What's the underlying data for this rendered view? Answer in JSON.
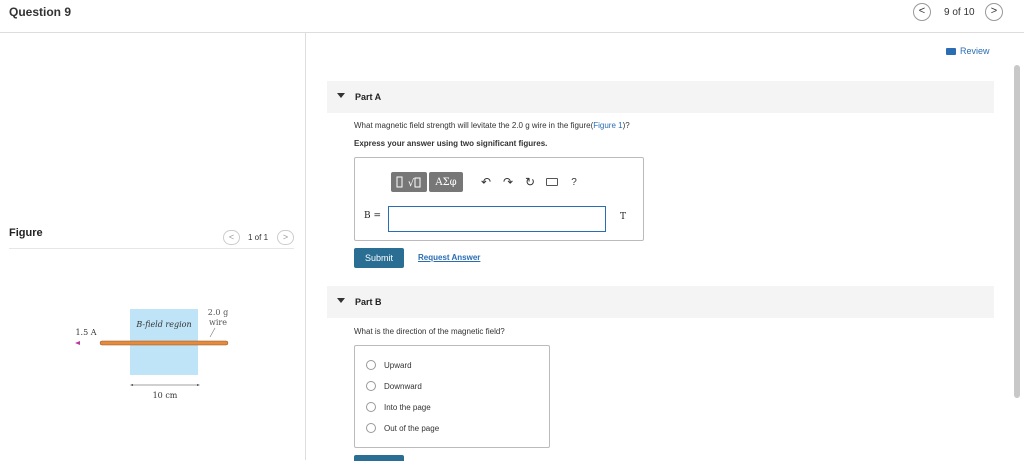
{
  "header": {
    "question_title": "Question 9",
    "nav_prev": "<",
    "nav_next": ">",
    "position": "9 of 10"
  },
  "figure_panel": {
    "label": "Figure",
    "pager": "1 of 1",
    "prev": "<",
    "next": ">",
    "figure": {
      "current_label": "1.5 A",
      "region_label": "B-field region",
      "wire_mass_line1": "2.0 g",
      "wire_mass_line2": "wire",
      "width_label": "10 cm"
    }
  },
  "review": "Review",
  "part_a": {
    "title": "Part A",
    "question_before": "What magnetic field strength will levitate the 2.0 g wire in the figure(",
    "figure_link": "Figure 1",
    "question_after": ")?",
    "instruction": "Express your answer using two significant figures.",
    "toolbar": {
      "greek": "ΑΣφ",
      "undo": "↶",
      "redo": "↷",
      "reset": "↻",
      "help": "?"
    },
    "var_label": "B =",
    "answer_value": "",
    "unit": "T",
    "submit": "Submit",
    "request_answer": "Request Answer"
  },
  "part_b": {
    "title": "Part B",
    "question": "What is the direction of the magnetic field?",
    "options": [
      "Upward",
      "Downward",
      "Into the page",
      "Out of the page"
    ]
  },
  "colors": {
    "accent": "#2a6e94",
    "link": "#2a6db3",
    "region": "#bfe4f7",
    "wire": "#e88a3a"
  }
}
